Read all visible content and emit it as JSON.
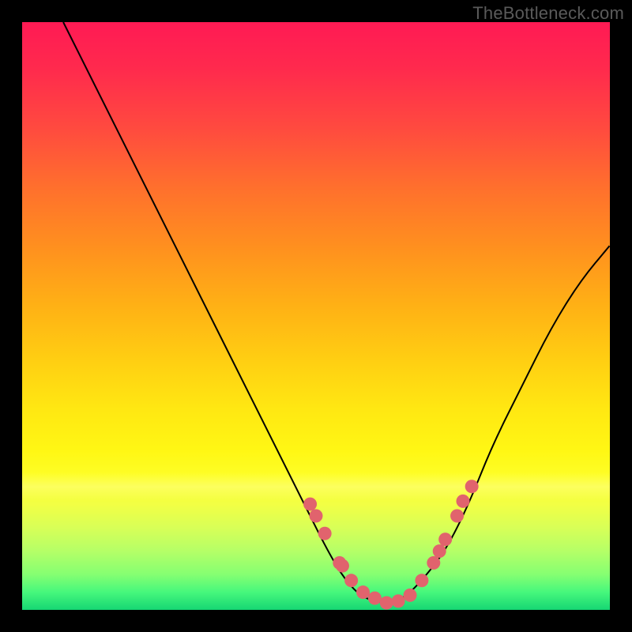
{
  "attribution": "TheBottleneck.com",
  "chart_data": {
    "type": "line",
    "title": "",
    "xlabel": "",
    "ylabel": "",
    "xlim": [
      0,
      100
    ],
    "ylim": [
      0,
      100
    ],
    "curve": {
      "name": "bottleneck-curve",
      "x": [
        7,
        12,
        18,
        24,
        30,
        36,
        42,
        48,
        52,
        55,
        58,
        62,
        65,
        68,
        72,
        76,
        80,
        85,
        90,
        95,
        100
      ],
      "y": [
        100,
        90,
        78,
        66,
        54,
        42,
        30,
        18,
        10,
        5,
        2,
        1,
        2,
        5,
        10,
        18,
        28,
        38,
        48,
        56,
        62
      ]
    },
    "markers": {
      "name": "highlight-dots",
      "color": "#e1636d",
      "x": [
        49,
        50,
        51.5,
        54,
        54.5,
        56,
        58,
        60,
        62,
        64,
        66,
        68,
        70,
        71,
        72,
        74,
        75,
        76.5
      ],
      "y": [
        18,
        16,
        13,
        8,
        7.5,
        5,
        3,
        2,
        1.2,
        1.5,
        2.5,
        5,
        8,
        10,
        12,
        16,
        18.5,
        21
      ]
    },
    "background_gradient": {
      "top_color": "#ff1a54",
      "bottom_color": "#16d673",
      "direction": "vertical"
    }
  }
}
